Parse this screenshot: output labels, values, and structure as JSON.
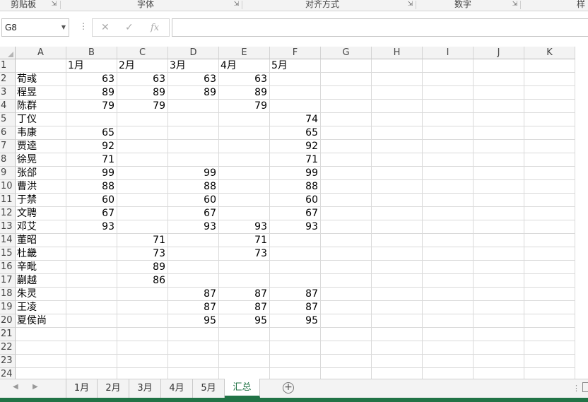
{
  "ribbon": {
    "groups": [
      {
        "label": "剪贴板",
        "has_launcher": true
      },
      {
        "label": "字体",
        "has_launcher": true
      },
      {
        "label": "对齐方式",
        "has_launcher": true
      },
      {
        "label": "数字",
        "has_launcher": true
      },
      {
        "label": "样",
        "has_launcher": false
      }
    ]
  },
  "formula_bar": {
    "name_box": "G8",
    "formula": ""
  },
  "columns": [
    "A",
    "B",
    "C",
    "D",
    "E",
    "F",
    "G",
    "H",
    "I",
    "J",
    "K"
  ],
  "row_numbers": [
    "1",
    "2",
    "3",
    "4",
    "5",
    "6",
    "7",
    "8",
    "9",
    "10",
    "11",
    "12",
    "13",
    "14",
    "15",
    "16",
    "17",
    "18",
    "19",
    "20",
    "21",
    "22",
    "23",
    "24"
  ],
  "sheet": {
    "header": [
      "",
      "1月",
      "2月",
      "3月",
      "4月",
      "5月"
    ],
    "rows": [
      {
        "name": "荀彧",
        "values": [
          "63",
          "63",
          "63",
          "63",
          ""
        ]
      },
      {
        "name": "程昱",
        "values": [
          "89",
          "89",
          "89",
          "89",
          ""
        ]
      },
      {
        "name": "陈群",
        "values": [
          "79",
          "79",
          "",
          "79",
          ""
        ]
      },
      {
        "name": "丁仪",
        "values": [
          "",
          "",
          "",
          "",
          "74"
        ]
      },
      {
        "name": "韦康",
        "values": [
          "65",
          "",
          "",
          "",
          "65"
        ]
      },
      {
        "name": "贾逵",
        "values": [
          "92",
          "",
          "",
          "",
          "92"
        ]
      },
      {
        "name": "徐晃",
        "values": [
          "71",
          "",
          "",
          "",
          "71"
        ]
      },
      {
        "name": "张郃",
        "values": [
          "99",
          "",
          "99",
          "",
          "99"
        ]
      },
      {
        "name": "曹洪",
        "values": [
          "88",
          "",
          "88",
          "",
          "88"
        ]
      },
      {
        "name": "于禁",
        "values": [
          "60",
          "",
          "60",
          "",
          "60"
        ]
      },
      {
        "name": "文聘",
        "values": [
          "67",
          "",
          "67",
          "",
          "67"
        ]
      },
      {
        "name": "邓艾",
        "values": [
          "93",
          "",
          "93",
          "93",
          "93"
        ]
      },
      {
        "name": "董昭",
        "values": [
          "",
          "71",
          "",
          "71",
          ""
        ]
      },
      {
        "name": "杜畿",
        "values": [
          "",
          "73",
          "",
          "73",
          ""
        ]
      },
      {
        "name": "辛毗",
        "values": [
          "",
          "89",
          "",
          "",
          ""
        ]
      },
      {
        "name": "蒯越",
        "values": [
          "",
          "86",
          "",
          "",
          ""
        ]
      },
      {
        "name": "朱灵",
        "values": [
          "",
          "",
          "87",
          "87",
          "87"
        ]
      },
      {
        "name": "王凌",
        "values": [
          "",
          "",
          "87",
          "87",
          "87"
        ]
      },
      {
        "name": "夏侯尚",
        "values": [
          "",
          "",
          "95",
          "95",
          "95"
        ]
      }
    ]
  },
  "tabs": {
    "items": [
      {
        "label": "1月",
        "active": false
      },
      {
        "label": "2月",
        "active": false
      },
      {
        "label": "3月",
        "active": false
      },
      {
        "label": "4月",
        "active": false
      },
      {
        "label": "5月",
        "active": false
      },
      {
        "label": "汇总",
        "active": true
      }
    ]
  },
  "colors": {
    "accent": "#217346"
  }
}
